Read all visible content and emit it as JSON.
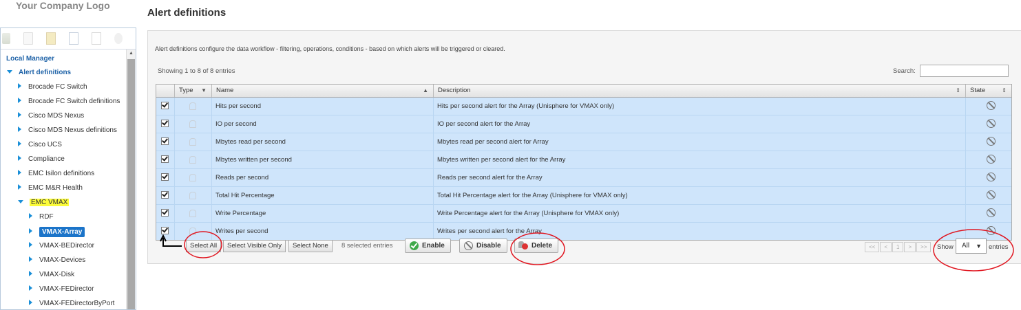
{
  "logo": {
    "text": "Your Company Logo"
  },
  "page": {
    "title": "Alert definitions"
  },
  "tree": {
    "root": "Local Manager",
    "items": [
      {
        "label": "Alert definitions"
      },
      {
        "label": "Brocade FC Switch"
      },
      {
        "label": "Brocade FC Switch definitions"
      },
      {
        "label": "Cisco MDS Nexus"
      },
      {
        "label": "Cisco MDS Nexus definitions"
      },
      {
        "label": "Cisco UCS"
      },
      {
        "label": "Compliance"
      },
      {
        "label": "EMC Isilon definitions"
      },
      {
        "label": "EMC M&R Health"
      },
      {
        "label": "EMC VMAX"
      },
      {
        "label": "RDF"
      },
      {
        "label": "VMAX-Array"
      },
      {
        "label": "VMAX-BEDirector"
      },
      {
        "label": "VMAX-Devices"
      },
      {
        "label": "VMAX-Disk"
      },
      {
        "label": "VMAX-FEDirector"
      },
      {
        "label": "VMAX-FEDirectorByPort"
      }
    ]
  },
  "main": {
    "description": "Alert definitions configure the data workflow - filtering, operations, conditions - based on which alerts will be triggered or cleared.",
    "showing": "Showing 1 to 8 of 8 entries",
    "search_label": "Search:",
    "search_value": ""
  },
  "table": {
    "headers": {
      "type": "Type",
      "name": "Name",
      "description": "Description",
      "state": "State"
    },
    "rows": [
      {
        "name": "Hits per second",
        "description": "Hits per second alert for the Array (Unisphere for VMAX only)"
      },
      {
        "name": "IO per second",
        "description": "IO per second alert for the Array"
      },
      {
        "name": "Mbytes read per second",
        "description": "Mbytes read per second alert for Array"
      },
      {
        "name": "Mbytes written per second",
        "description": "Mbytes written per second alert for the Array"
      },
      {
        "name": "Reads per second",
        "description": "Reads per second alert for the Array"
      },
      {
        "name": "Total Hit Percentage",
        "description": "Total Hit Percentage alert for the Array (Unisphere for VMAX only)"
      },
      {
        "name": "Write Percentage",
        "description": "Write Percentage alert for the Array (Unisphere for VMAX only)"
      },
      {
        "name": "Writes per second",
        "description": "Writes per second alert for the Array"
      }
    ]
  },
  "footer": {
    "select_all": "Select All",
    "select_visible": "Select Visible Only",
    "select_none": "Select None",
    "selected_entries": "8 selected entries",
    "enable": "Enable",
    "disable": "Disable",
    "delete": "Delete",
    "pager": {
      "first": "<<",
      "prev": "<",
      "page": "1",
      "next": ">",
      "last": ">>"
    },
    "show_label": "Show",
    "show_value": "All",
    "entries_label": "entries"
  },
  "colors": {
    "row_bg": "#cfe5fb",
    "tree_arrow": "#1a8fd8",
    "selected": "#1b74c9",
    "highlight": "#fbfb3a",
    "annotation": "#e0141e"
  }
}
